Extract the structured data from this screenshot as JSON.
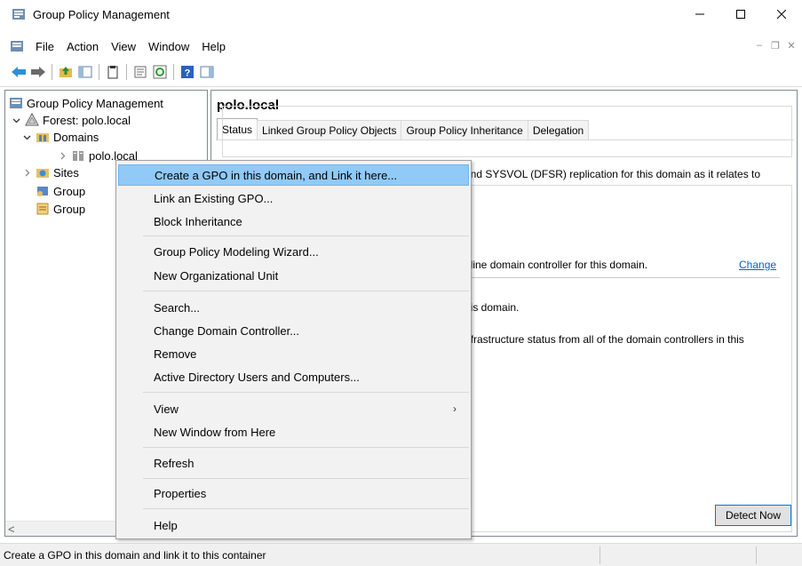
{
  "window": {
    "title": "Group Policy Management"
  },
  "menubar": {
    "items": [
      "File",
      "Action",
      "View",
      "Window",
      "Help"
    ]
  },
  "tree": {
    "root": "Group Policy Management",
    "forest": "Forest: polo.local",
    "domains": "Domains",
    "domain": "polo.local",
    "sites": "Sites",
    "gp_modeling": "Group",
    "gp_results": "Group"
  },
  "right_pane": {
    "title": "polo.local",
    "tabs": [
      "Status",
      "Linked Group Policy Objects",
      "Group Policy Inheritance",
      "Delegation"
    ],
    "active_tab": "Status",
    "text1": "and SYSVOL (DFSR) replication for this domain as it relates to",
    "text2": "eline domain controller for this domain.",
    "change_link": "Change",
    "text3": "his domain.",
    "text4": "nfrastructure status from all of the domain controllers in this",
    "detect_button": "Detect Now"
  },
  "context_menu": {
    "items": [
      {
        "label": "Create a GPO in this domain, and Link it here...",
        "highlighted": true
      },
      {
        "label": "Link an Existing GPO..."
      },
      {
        "label": "Block Inheritance"
      },
      {
        "label": "Group Policy Modeling Wizard..."
      },
      {
        "label": "New Organizational Unit"
      },
      {
        "label": "Search..."
      },
      {
        "label": "Change Domain Controller..."
      },
      {
        "label": "Remove"
      },
      {
        "label": "Active Directory Users and Computers..."
      },
      {
        "label": "View",
        "submenu": true
      },
      {
        "label": "New Window from Here"
      },
      {
        "label": "Refresh"
      },
      {
        "label": "Properties"
      },
      {
        "label": "Help"
      }
    ]
  },
  "statusbar": {
    "text": "Create a GPO in this domain and link it to this container"
  },
  "colors": {
    "highlight": "#91c9f7",
    "menu_bg": "#f2f2f2",
    "link": "#0066cc",
    "button_border": "#0078d7"
  }
}
